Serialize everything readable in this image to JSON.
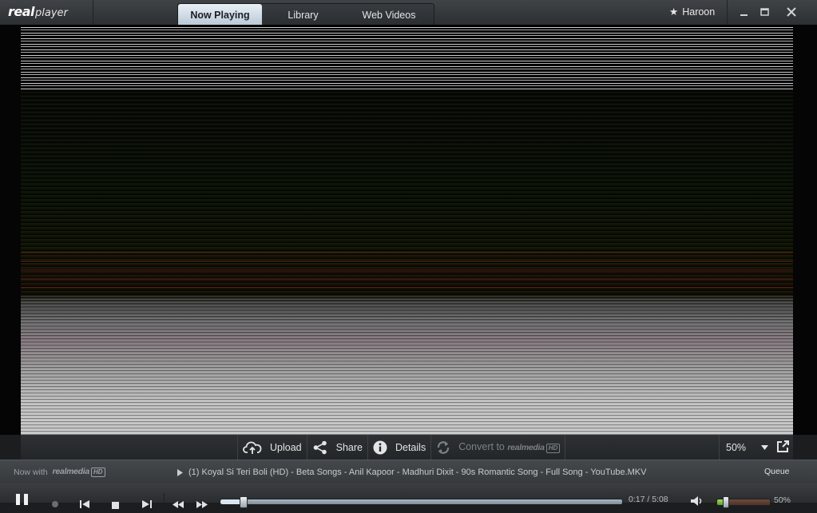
{
  "app": {
    "logo_real": "real",
    "logo_player": "player"
  },
  "tabs": [
    {
      "label": "Now Playing",
      "active": true
    },
    {
      "label": "Library",
      "active": false
    },
    {
      "label": "Web Videos",
      "active": false
    }
  ],
  "user": {
    "name": "Haroon",
    "icon": "star-icon"
  },
  "actions": {
    "upload": "Upload",
    "share": "Share",
    "details": "Details",
    "convert": "Convert to",
    "convert_brand": "realmedia",
    "convert_hd": "HD"
  },
  "zoom": {
    "value": "50%"
  },
  "status": {
    "now_with": "Now with",
    "brand": "realmedia",
    "hd": "HD",
    "track_title": "(1) Koyal Si Teri Boli (HD) - Beta Songs - Anil Kapoor - Madhuri Dixit - 90s Romantic Song - Full Song - YouTube.MKV",
    "queue": "Queue"
  },
  "playback": {
    "time": "0:17 / 5:08",
    "progress_fraction": 0.055,
    "volume_percent": 50,
    "volume_label": "50%"
  },
  "colors": {
    "accent_tab": "#dce6ef",
    "volume_green": "#7cc141"
  }
}
